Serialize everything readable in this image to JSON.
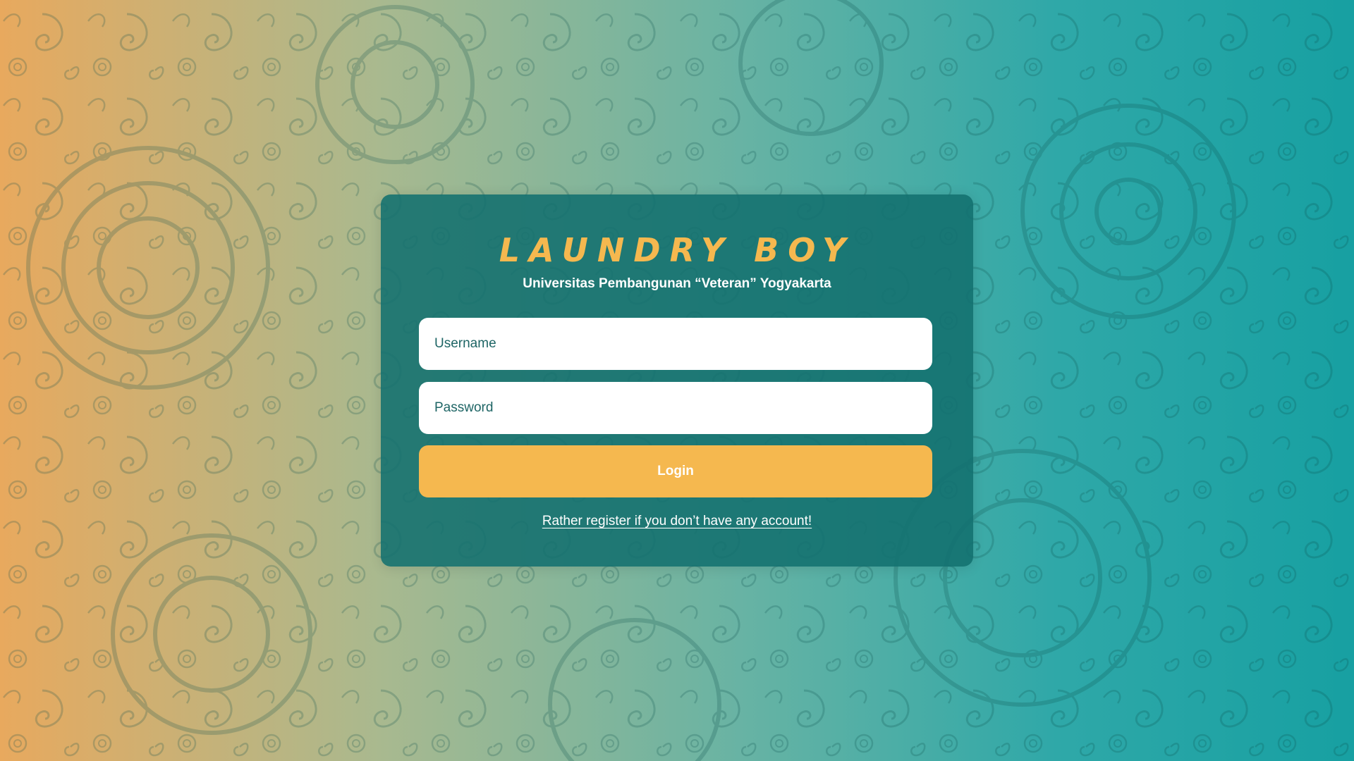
{
  "login": {
    "brand": "LAUNDRY BOY",
    "subtitle": "Universitas Pembangunan “Veteran” Yogyakarta",
    "username_placeholder": "Username",
    "password_placeholder": "Password",
    "login_label": "Login",
    "register_link": "Rather register if you don’t have any account!"
  },
  "colors": {
    "accent": "#f5b84f",
    "card": "#12706e",
    "background_left": "#e8a95e",
    "background_right": "#17a0a2"
  }
}
